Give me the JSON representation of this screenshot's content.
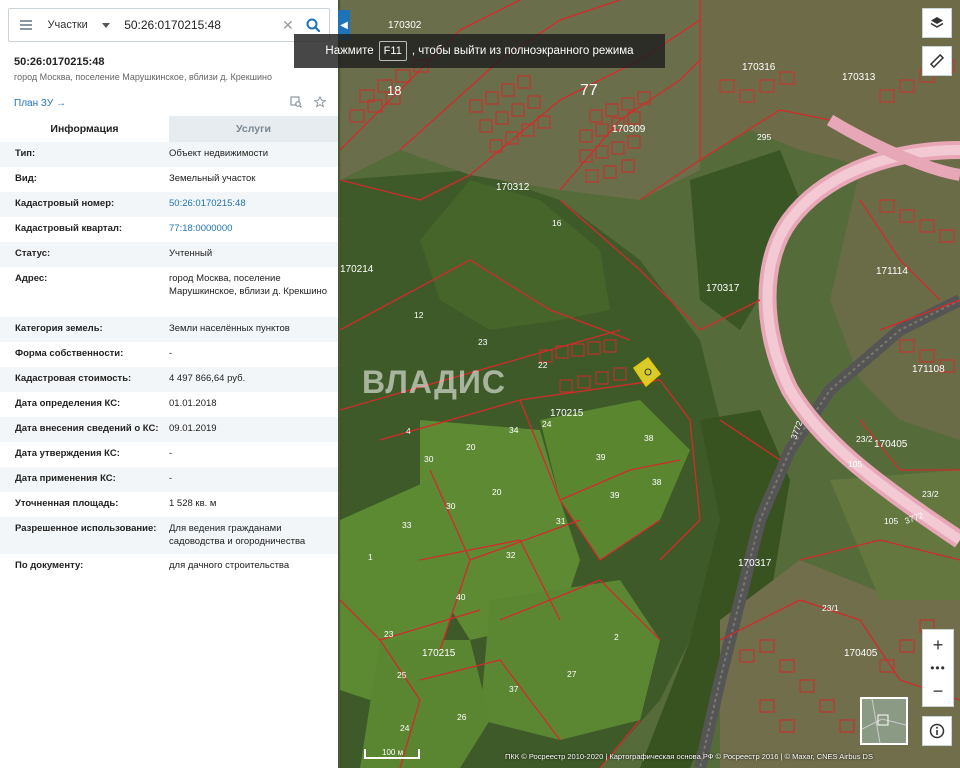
{
  "search": {
    "layer": "Участки",
    "value": "50:26:0170215:48",
    "clear": "✕"
  },
  "collapse_glyph": "◀",
  "object": {
    "title": "50:26:0170215:48",
    "subtitle": "город Москва, поселение Марушкинское, вблизи д. Крекшино",
    "plan_link": "План ЗУ →"
  },
  "tabs": [
    {
      "label": "Информация",
      "active": true
    },
    {
      "label": "Услуги",
      "active": false
    }
  ],
  "info_rows": [
    {
      "label": "Тип:",
      "value": "Объект недвижимости"
    },
    {
      "label": "Вид:",
      "value": "Земельный участок"
    },
    {
      "label": "Кадастровый номер:",
      "value": "50:26:0170215:48",
      "link": true
    },
    {
      "label": "Кадастровый квартал:",
      "value": "77:18:0000000",
      "link": true
    },
    {
      "label": "Статус:",
      "value": "Учтенный"
    },
    {
      "label": "Адрес:",
      "value": "город Москва, поселение Марушкинское, вблизи д. Крекшино"
    },
    {
      "label": "Категория земель:",
      "value": "Земли населённых пунктов"
    },
    {
      "label": "Форма собственности:",
      "value": "-"
    },
    {
      "label": "Кадастровая стоимость:",
      "value": "4 497 866,64 руб."
    },
    {
      "label": "Дата определения КС:",
      "value": "01.01.2018"
    },
    {
      "label": "Дата внесения сведений о КС:",
      "value": "09.01.2019"
    },
    {
      "label": "Дата утверждения КС:",
      "value": "-"
    },
    {
      "label": "Дата применения КС:",
      "value": "-"
    },
    {
      "label": "Уточненная площадь:",
      "value": "1 528 кв. м"
    },
    {
      "label": "Разрешенное использование:",
      "value": "Для ведения гражданами садоводства и огородничества"
    },
    {
      "label": "По документу:",
      "value": "для дачного строительства"
    }
  ],
  "fullscreen_hint": {
    "before": "Нажмите",
    "key": "F11",
    "after": ", чтобы выйти из полноэкранного режима"
  },
  "zoom": {
    "plus": "+",
    "dots": "•••",
    "minus": "−"
  },
  "attribution": "ПКК © Росреестр 2010-2020 | Картографическая основа РФ © Росреестр 2016 | © Maxar, CNES Airbus DS",
  "scale_label": "100 м",
  "watermark": "ВЛАДИС",
  "map_labels": {
    "quarters": [
      "170302",
      "170316",
      "170313",
      "170309",
      "170312",
      "170214",
      "170317",
      "171114",
      "171108",
      "170405",
      "170215",
      "170317",
      "170405",
      "170215"
    ],
    "parcels": [
      "18",
      "77",
      "16",
      "12",
      "23",
      "22",
      "4",
      "30",
      "34",
      "24",
      "20",
      "38",
      "39",
      "38",
      "39",
      "20",
      "31",
      "33",
      "30",
      "32",
      "1",
      "40",
      "23",
      "25",
      "24",
      "2",
      "27",
      "37",
      "26",
      "105",
      "105",
      "23/2",
      "23/2",
      "23/1",
      "295",
      "3772",
      "3772"
    ]
  },
  "colors": {
    "accent": "#1e73b8",
    "parcel_border": "#d22b2b",
    "road": "#e6a6b6",
    "selected": "#f2df2e"
  }
}
